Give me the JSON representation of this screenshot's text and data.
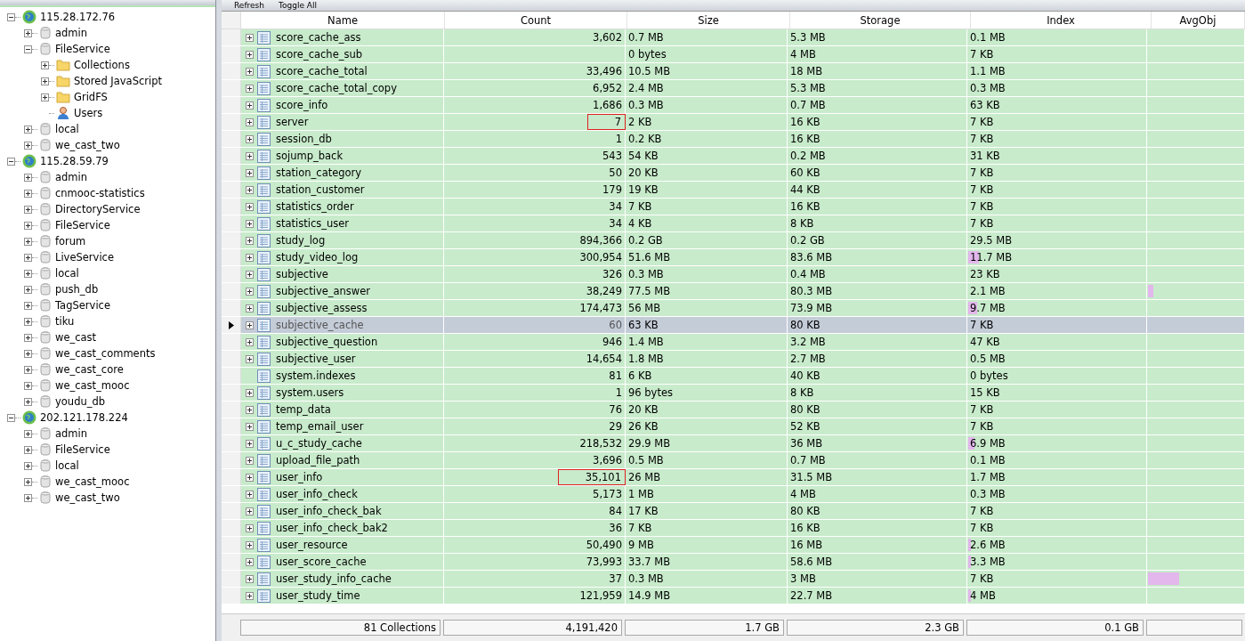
{
  "tree": [
    {
      "label": "115.28.172.76",
      "kind": "server",
      "expanded": true,
      "children": [
        {
          "label": "admin",
          "kind": "database",
          "expanded": false
        },
        {
          "label": "FileService",
          "kind": "database",
          "expanded": true,
          "children": [
            {
              "label": "Collections",
              "kind": "folder",
              "expanded": false
            },
            {
              "label": "Stored JavaScript",
              "kind": "folder",
              "expanded": false
            },
            {
              "label": "GridFS",
              "kind": "folder",
              "expanded": false
            },
            {
              "label": "Users",
              "kind": "user"
            }
          ]
        },
        {
          "label": "local",
          "kind": "database",
          "expanded": false
        },
        {
          "label": "we_cast_two",
          "kind": "database",
          "expanded": false
        }
      ]
    },
    {
      "label": "115.28.59.79",
      "kind": "server",
      "expanded": true,
      "children": [
        {
          "label": "admin",
          "kind": "database",
          "expanded": false
        },
        {
          "label": "cnmooc-statistics",
          "kind": "database",
          "expanded": false
        },
        {
          "label": "DirectoryService",
          "kind": "database",
          "expanded": false
        },
        {
          "label": "FileService",
          "kind": "database",
          "expanded": false
        },
        {
          "label": "forum",
          "kind": "database",
          "expanded": false
        },
        {
          "label": "LiveService",
          "kind": "database",
          "expanded": false
        },
        {
          "label": "local",
          "kind": "database",
          "expanded": false
        },
        {
          "label": "push_db",
          "kind": "database",
          "expanded": false
        },
        {
          "label": "TagService",
          "kind": "database",
          "expanded": false
        },
        {
          "label": "tiku",
          "kind": "database",
          "expanded": false
        },
        {
          "label": "we_cast",
          "kind": "database",
          "expanded": false
        },
        {
          "label": "we_cast_comments",
          "kind": "database",
          "expanded": false
        },
        {
          "label": "we_cast_core",
          "kind": "database",
          "expanded": false
        },
        {
          "label": "we_cast_mooc",
          "kind": "database",
          "expanded": false
        },
        {
          "label": "youdu_db",
          "kind": "database",
          "expanded": false
        }
      ]
    },
    {
      "label": "202.121.178.224",
      "kind": "server",
      "expanded": true,
      "children": [
        {
          "label": "admin",
          "kind": "database",
          "expanded": false
        },
        {
          "label": "FileService",
          "kind": "database",
          "expanded": false
        },
        {
          "label": "local",
          "kind": "database",
          "expanded": false
        },
        {
          "label": "we_cast_mooc",
          "kind": "database",
          "expanded": false
        },
        {
          "label": "we_cast_two",
          "kind": "database",
          "expanded": false
        }
      ]
    }
  ],
  "toolbar": [
    "Refresh",
    "Toggle All"
  ],
  "table": {
    "columns": [
      "Name",
      "Count",
      "Size",
      "Storage",
      "Index",
      "AvgObj"
    ],
    "rows": [
      {
        "name": "score_cache_ass",
        "count": "3,602",
        "size": "0.7 MB",
        "storage": "5.3 MB",
        "index": "0.1 MB",
        "expandable": true,
        "selected": false
      },
      {
        "name": "score_cache_sub",
        "size": "0 bytes",
        "storage": "4 MB",
        "index": "7 KB",
        "expandable": true,
        "selected": false
      },
      {
        "name": "score_cache_total",
        "count": "33,496",
        "size": "10.5 MB",
        "storage": "18 MB",
        "index": "1.1 MB",
        "expandable": true,
        "selected": false
      },
      {
        "name": "score_cache_total_copy",
        "count": "6,952",
        "size": "2.4 MB",
        "storage": "5.3 MB",
        "index": "0.3 MB",
        "expandable": true,
        "selected": false
      },
      {
        "name": "score_info",
        "count": "1,686",
        "size": "0.3 MB",
        "storage": "0.7 MB",
        "index": "63 KB",
        "expandable": true,
        "selected": false
      },
      {
        "name": "server",
        "count": "7",
        "size": "2 KB",
        "storage": "16 KB",
        "index": "7 KB",
        "expandable": true,
        "selected": false,
        "highlighted": true
      },
      {
        "name": "session_db",
        "count": "1",
        "size": "0.2 KB",
        "storage": "16 KB",
        "index": "7 KB",
        "expandable": true,
        "selected": false
      },
      {
        "name": "sojump_back",
        "count": "543",
        "size": "54 KB",
        "storage": "0.2 MB",
        "index": "31 KB",
        "expandable": true,
        "selected": false
      },
      {
        "name": "station_category",
        "count": "50",
        "size": "20 KB",
        "storage": "60 KB",
        "index": "7 KB",
        "expandable": true,
        "selected": false
      },
      {
        "name": "station_customer",
        "count": "179",
        "size": "19 KB",
        "storage": "44 KB",
        "index": "7 KB",
        "expandable": true,
        "selected": false
      },
      {
        "name": "statistics_order",
        "count": "34",
        "size": "7 KB",
        "storage": "16 KB",
        "index": "7 KB",
        "expandable": true,
        "selected": false
      },
      {
        "name": "statistics_user",
        "count": "34",
        "size": "4 KB",
        "storage": "8 KB",
        "index": "7 KB",
        "expandable": true,
        "selected": false
      },
      {
        "name": "study_log",
        "count": "894,366",
        "size": "0.2 GB",
        "storage": "0.2 GB",
        "index": "29.5 MB",
        "expandable": true,
        "selected": false
      },
      {
        "name": "study_video_log",
        "count": "300,954",
        "size": "51.6 MB",
        "storage": "83.6 MB",
        "index": "11.7 MB",
        "expandable": true,
        "selected": false,
        "index_bar": {
          "level": 0.06
        }
      },
      {
        "name": "subjective",
        "count": "326",
        "size": "0.3 MB",
        "storage": "0.4 MB",
        "index": "23 KB",
        "expandable": true,
        "selected": false
      },
      {
        "name": "subjective_answer",
        "count": "38,249",
        "size": "77.5 MB",
        "storage": "80.3 MB",
        "index": "2.1 MB",
        "expandable": true,
        "selected": false,
        "avgobj_bar": {
          "level": 0.05
        }
      },
      {
        "name": "subjective_assess",
        "count": "174,473",
        "size": "56 MB",
        "storage": "73.9 MB",
        "index": "9.7 MB",
        "expandable": true,
        "selected": false,
        "index_bar": {
          "level": 0.05
        }
      },
      {
        "name": "subjective_cache",
        "count": "60",
        "size": "63 KB",
        "storage": "80 KB",
        "index": "7 KB",
        "expandable": true,
        "selected": true
      },
      {
        "name": "subjective_question",
        "count": "946",
        "size": "1.4 MB",
        "storage": "3.2 MB",
        "index": "47 KB",
        "expandable": true,
        "selected": false
      },
      {
        "name": "subjective_user",
        "count": "14,654",
        "size": "1.8 MB",
        "storage": "2.7 MB",
        "index": "0.5 MB",
        "expandable": true,
        "selected": false
      },
      {
        "name": "system.indexes",
        "count": "81",
        "size": "6 KB",
        "storage": "40 KB",
        "index": "0 bytes",
        "expandable": false,
        "selected": false
      },
      {
        "name": "system.users",
        "count": "1",
        "size": "96 bytes",
        "storage": "8 KB",
        "index": "15 KB",
        "expandable": true,
        "selected": false
      },
      {
        "name": "temp_data",
        "count": "76",
        "size": "20 KB",
        "storage": "80 KB",
        "index": "7 KB",
        "expandable": true,
        "selected": false
      },
      {
        "name": "temp_email_user",
        "count": "29",
        "size": "26 KB",
        "storage": "52 KB",
        "index": "7 KB",
        "expandable": true,
        "selected": false
      },
      {
        "name": "u_c_study_cache",
        "count": "218,532",
        "size": "29.9 MB",
        "storage": "36 MB",
        "index": "6.9 MB",
        "expandable": true,
        "selected": false,
        "index_bar": {
          "level": 0.035
        }
      },
      {
        "name": "upload_file_path",
        "count": "3,696",
        "size": "0.5 MB",
        "storage": "0.7 MB",
        "index": "0.1 MB",
        "expandable": true,
        "selected": false
      },
      {
        "name": "user_info",
        "count": "35,101",
        "size": "26 MB",
        "storage": "31.5 MB",
        "index": "1.7 MB",
        "expandable": true,
        "selected": false,
        "highlighted": true
      },
      {
        "name": "user_info_check",
        "count": "5,173",
        "size": "1 MB",
        "storage": "4 MB",
        "index": "0.3 MB",
        "expandable": true,
        "selected": false
      },
      {
        "name": "user_info_check_bak",
        "count": "84",
        "size": "17 KB",
        "storage": "80 KB",
        "index": "7 KB",
        "expandable": true,
        "selected": false
      },
      {
        "name": "user_info_check_bak2",
        "count": "36",
        "size": "7 KB",
        "storage": "16 KB",
        "index": "7 KB",
        "expandable": true,
        "selected": false
      },
      {
        "name": "user_resource",
        "count": "50,490",
        "size": "9 MB",
        "storage": "16 MB",
        "index": "2.6 MB",
        "expandable": true,
        "selected": false,
        "index_bar": {
          "level": 0.015
        }
      },
      {
        "name": "user_score_cache",
        "count": "73,993",
        "size": "33.7 MB",
        "storage": "58.6 MB",
        "index": "3.3 MB",
        "expandable": true,
        "selected": false,
        "index_bar": {
          "level": 0.015
        }
      },
      {
        "name": "user_study_info_cache",
        "count": "37",
        "size": "0.3 MB",
        "storage": "3 MB",
        "index": "7 KB",
        "expandable": true,
        "selected": false,
        "avgobj_bar": {
          "level": 0.32
        }
      },
      {
        "name": "user_study_time",
        "count": "121,959",
        "size": "14.9 MB",
        "storage": "22.7 MB",
        "index": "4 MB",
        "expandable": true,
        "selected": false,
        "index_bar": {
          "level": 0.015
        }
      }
    ]
  },
  "totals": {
    "name": "81 Collections",
    "count": "4,191,420",
    "size": "1.7 GB",
    "storage": "2.3 GB",
    "index": "0.1 GB"
  }
}
